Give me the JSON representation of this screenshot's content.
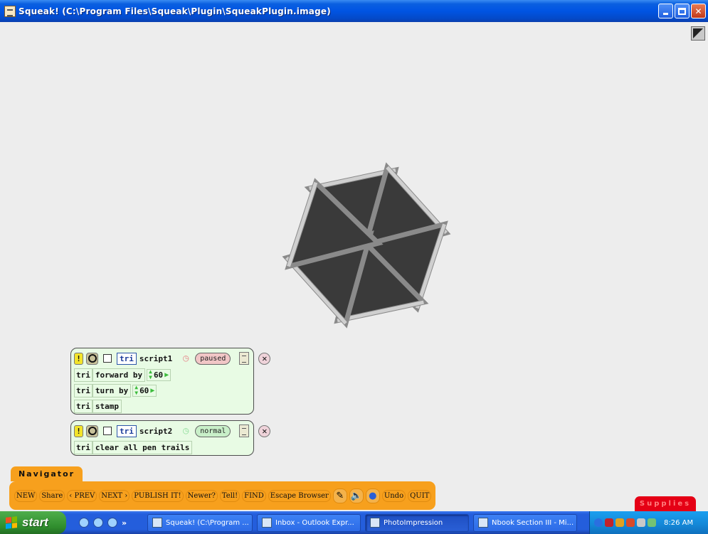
{
  "window": {
    "title": "Squeak! (C:\\Program Files\\Squeak\\Plugin\\SqueakPlugin.image)",
    "buttons": [
      "minimize",
      "maximize",
      "close"
    ]
  },
  "script1": {
    "bang": "!",
    "player": "tri",
    "name": "script1",
    "status": "paused",
    "close": "✕",
    "rows": [
      {
        "player": "tri",
        "command": "forward by",
        "value": "60"
      },
      {
        "player": "tri",
        "command": "turn by",
        "value": "60"
      },
      {
        "player": "tri",
        "command": "stamp"
      }
    ]
  },
  "script2": {
    "bang": "!",
    "player": "tri",
    "name": "script2",
    "status": "normal",
    "close": "✕",
    "rows": [
      {
        "player": "tri",
        "command": "clear all pen trails"
      }
    ]
  },
  "navigator": {
    "tab_label": "Navigator",
    "buttons": [
      "NEW",
      "Share",
      "‹ PREV",
      "NEXT ›",
      "PUBLISH IT!",
      "Newer?",
      "Tell!",
      "FIND",
      "Escape Browser"
    ],
    "icons": [
      "paint-brush-icon",
      "speaker-icon",
      "globe-icon"
    ],
    "undo_label": "Undo",
    "quit_label": "QUIT"
  },
  "supplies_label": "Supplies",
  "taskbar": {
    "start_label": "start",
    "more": "»",
    "tasks": [
      {
        "label": "Squeak! (C:\\Program ...",
        "active": false
      },
      {
        "label": "Inbox - Outlook Expr...",
        "active": false
      },
      {
        "label": "PhotoImpression",
        "active": true
      },
      {
        "label": "Nbook Section III - Mi...",
        "active": false
      }
    ],
    "clock": "8:26 AM"
  },
  "colors": {
    "titlebar": "#0054e3",
    "desktop": "#ededed",
    "script_bg": "#e8fbe4",
    "navigator": "#f7a01d",
    "supplies": "#e50015",
    "triangle_fill": "#3a3a3a"
  }
}
